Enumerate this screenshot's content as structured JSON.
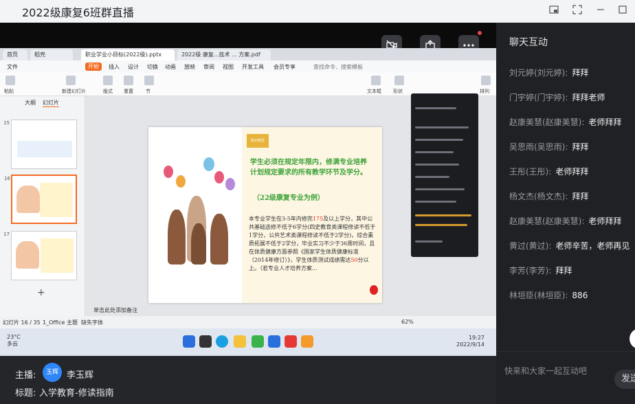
{
  "window": {
    "title": "2022级康复6班群直播"
  },
  "video_controls": {
    "camera_icon": "camera-off-icon",
    "share_icon": "share-screen-icon",
    "more_icon": "more-dots-icon"
  },
  "shared_screen": {
    "tabs": [
      "首页",
      "稻壳",
      "职业学业小目标(2022级).pptx",
      "2022级 康复...技术 ... 方案.pdf"
    ],
    "menu": [
      "文件",
      "开始",
      "插入",
      "设计",
      "切换",
      "动画",
      "放映",
      "审阅",
      "视图",
      "开发工具",
      "会员专享"
    ],
    "menu_search": "查找命令、搜索模板",
    "ribbon_labels": [
      "粘贴",
      "新建幻灯片",
      "版式",
      "重置",
      "节",
      "文本框",
      "形状",
      "排列"
    ],
    "thumb_header": [
      "大纲",
      "幻灯片"
    ],
    "slide_numbers": [
      "15",
      "16",
      "17"
    ],
    "slide": {
      "tag": "知识普及",
      "heading": "学生必须在规定年限内，修满专业培养计划规定要求的所有教学环节及学分。",
      "heading2": "（22级康复专业为例）",
      "body_before_175": "本专业学生在3-5年内修完",
      "credits_total": "175",
      "body_after_175": "及以上学分，其中公共基础选修不低于6学分(四史教育类课程修读不低于1学分，公共艺术类课程修读不低于2学分)，综合素质拓展不低于2学分，毕业实习不少于36周时间，且在体质健康方面参照《国家学生体质健康标准（2014年修订）》，学生体质测试成绩需达",
      "pass_score": "50",
      "body_after_50": "分以上。（若专业人才培养方案..."
    },
    "status_left": "幻灯片 16 / 35",
    "status_theme": "1_Office 主题",
    "status_font": "缺失字体",
    "status_notes": "单击此处添加备注",
    "status_zoom": "62%",
    "weather_temp": "23°C",
    "weather_desc": "多云",
    "clock_time": "19:27",
    "clock_date": "2022/9/14"
  },
  "host": {
    "host_label": "主播:",
    "avatar_text": "玉辉",
    "host_name": "李玉辉",
    "topic_label": "标题:",
    "topic": "入学教育-修读指南"
  },
  "chat": {
    "header": "聊天互动",
    "messages": [
      {
        "who": "刘元婷(刘元婷):",
        "text": "拜拜"
      },
      {
        "who": "门宇婷(门宇婷):",
        "text": "拜拜老师"
      },
      {
        "who": "赵康美慧(赵康美慧):",
        "text": "老师拜拜"
      },
      {
        "who": "吴思雨(吴思雨):",
        "text": "拜拜"
      },
      {
        "who": "王彤(王彤):",
        "text": "老师拜拜"
      },
      {
        "who": "杨文杰(杨文杰):",
        "text": "拜拜"
      },
      {
        "who": "赵康美慧(赵康美慧):",
        "text": "老师拜拜"
      },
      {
        "who": "黄过(黄过):",
        "text": "老师辛苦，老师再见"
      },
      {
        "who": "李芳(李芳):",
        "text": "拜拜"
      },
      {
        "who": "林垣臣(林垣臣):",
        "text": "886"
      }
    ],
    "input_placeholder": "快来和大家一起互动吧",
    "send_label": "发送"
  }
}
